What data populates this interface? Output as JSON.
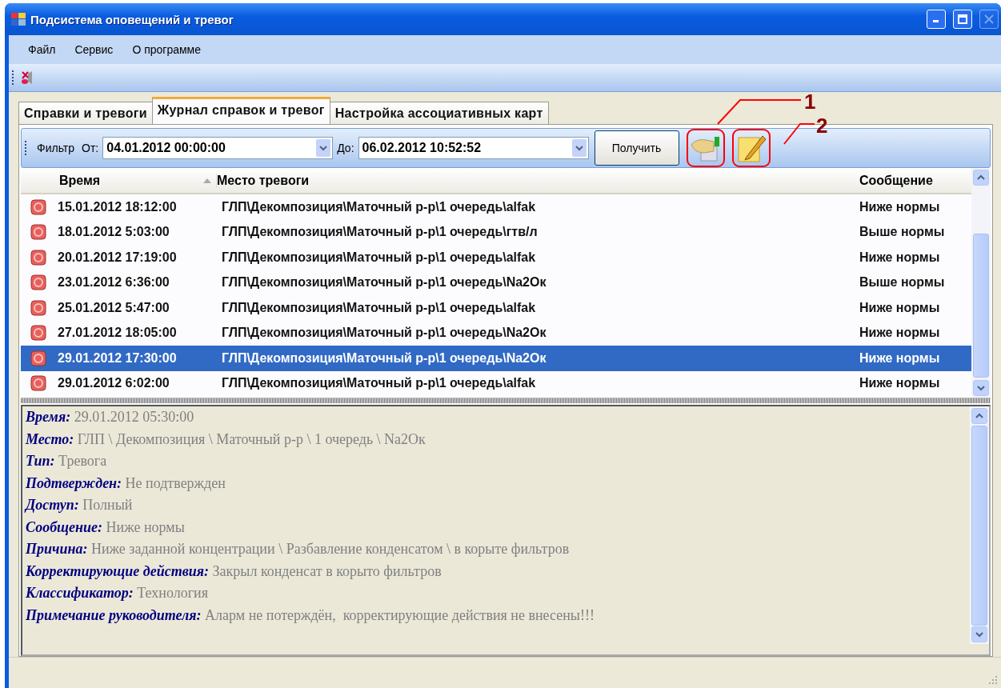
{
  "window": {
    "title": "Подсистема оповещений и тревог"
  },
  "menu": [
    "Файл",
    "Сервис",
    "О программе"
  ],
  "tabs": [
    {
      "label": "Справки и тревоги",
      "selected": false
    },
    {
      "label": "Журнал справок и тревог",
      "selected": true
    },
    {
      "label": "Настройка ассоциативных карт",
      "selected": false
    }
  ],
  "filter": {
    "label": "Фильтр",
    "from_label": "От:",
    "from_value": "04.01.2012 00:00:00",
    "to_label": "До:",
    "to_value": "06.02.2012 10:52:52",
    "button": "Получить"
  },
  "callouts": [
    "1",
    "2"
  ],
  "table": {
    "columns": [
      "Время",
      "Место тревоги",
      "Сообщение"
    ],
    "rows": [
      {
        "time": "15.01.2012 18:12:00",
        "place": "ГЛП\\Декомпозиция\\Маточный р-р\\1 очередь\\alfak",
        "message": "Ниже нормы",
        "selected": false
      },
      {
        "time": "18.01.2012 5:03:00",
        "place": "ГЛП\\Декомпозиция\\Маточный р-р\\1 очередь\\гтв/л",
        "message": "Выше нормы",
        "selected": false
      },
      {
        "time": "20.01.2012 17:19:00",
        "place": "ГЛП\\Декомпозиция\\Маточный р-р\\1 очередь\\alfak",
        "message": "Ниже нормы",
        "selected": false
      },
      {
        "time": "23.01.2012 6:36:00",
        "place": "ГЛП\\Декомпозиция\\Маточный р-р\\1 очередь\\Na2Oк",
        "message": "Выше нормы",
        "selected": false
      },
      {
        "time": "25.01.2012 5:47:00",
        "place": "ГЛП\\Декомпозиция\\Маточный р-р\\1 очередь\\alfak",
        "message": "Ниже нормы",
        "selected": false
      },
      {
        "time": "27.01.2012 18:05:00",
        "place": "ГЛП\\Декомпозиция\\Маточный р-р\\1 очередь\\Na2Oк",
        "message": "Ниже нормы",
        "selected": false
      },
      {
        "time": "29.01.2012 17:30:00",
        "place": "ГЛП\\Декомпозиция\\Маточный р-р\\1 очередь\\Na2Oк",
        "message": "Ниже нормы",
        "selected": true
      },
      {
        "time": "29.01.2012 6:02:00",
        "place": "ГЛП\\Декомпозиция\\Маточный р-р\\1 очередь\\alfak",
        "message": "Ниже нормы",
        "selected": false
      }
    ]
  },
  "details": [
    {
      "label": "Время:",
      "value": "29.01.2012 05:30:00"
    },
    {
      "label": "Место:",
      "value": "ГЛП \\ Декомпозиция \\ Маточный р-р \\ 1 очередь \\ Na2Oк"
    },
    {
      "label": "Тип:",
      "value": "Тревога"
    },
    {
      "label": "Подтвержден:",
      "value": "Не подтвержден"
    },
    {
      "label": "Доступ:",
      "value": "Полный"
    },
    {
      "label": "Сообщение:",
      "value": "Ниже нормы"
    },
    {
      "label": "Причина:",
      "value": "Ниже заданной концентрации \\ Разбавление конденсатом \\ в корыте фильтров"
    },
    {
      "label": "Корректирующие действия:",
      "value": "Закрыл конденсат в корыто фильтров"
    },
    {
      "label": "Классификатор:",
      "value": "Технология"
    },
    {
      "label": "Примечание руководителя:",
      "value": "Аларм не потерждён,  корректирующие действия не внесены!!!"
    }
  ]
}
